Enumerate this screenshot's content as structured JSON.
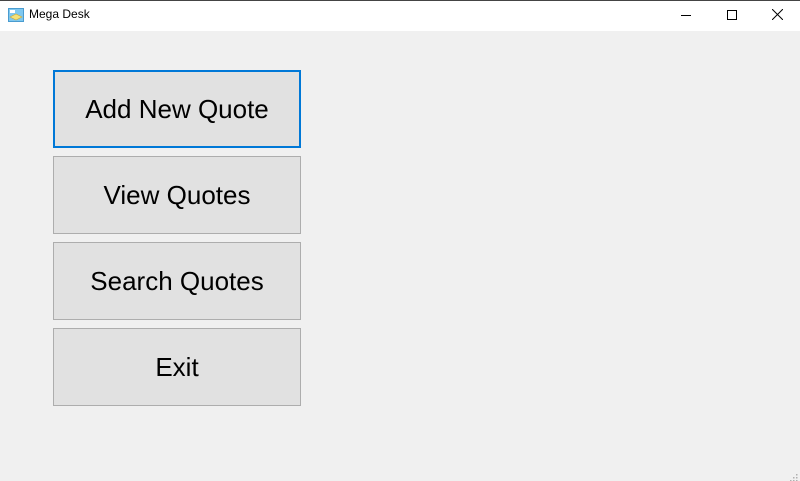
{
  "window": {
    "title": "Mega Desk",
    "icon": "app-icon",
    "controls": {
      "minimize_icon": "minimize-icon",
      "maximize_icon": "maximize-icon",
      "close_icon": "close-icon"
    }
  },
  "menu": {
    "add_label": "Add New Quote",
    "view_label": "View Quotes",
    "search_label": "Search Quotes",
    "exit_label": "Exit",
    "focused_button": "Add New Quote"
  },
  "colors": {
    "background": "#f0f0f0",
    "button_face": "#e1e1e1",
    "button_border": "#adadad",
    "focus_border": "#0078d7",
    "titlebar": "#ffffff"
  }
}
